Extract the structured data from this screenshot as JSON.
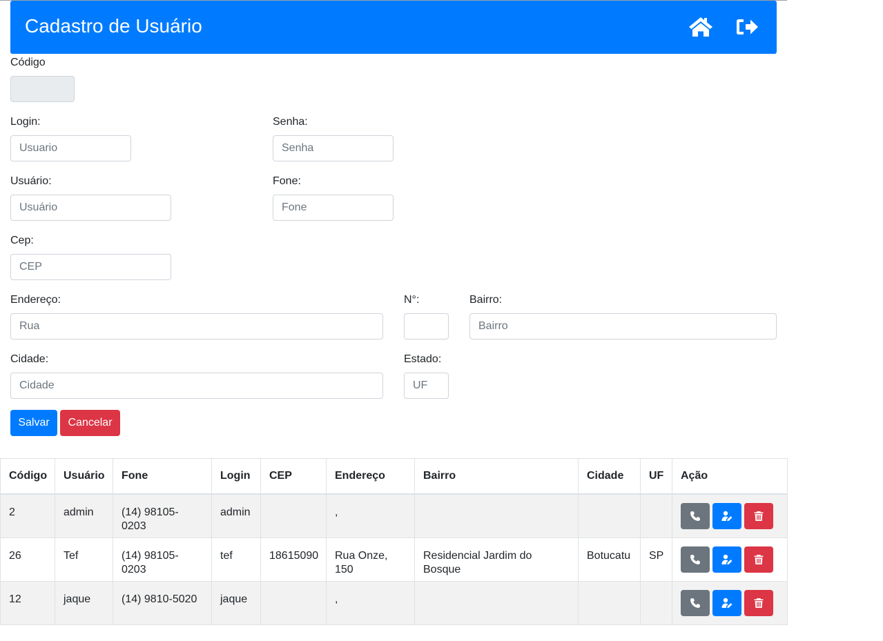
{
  "header": {
    "title": "Cadastro de Usuário",
    "home_icon": "home-icon",
    "logout_icon": "sign-out-icon"
  },
  "form": {
    "codigo_label": "Código",
    "login_label": "Login:",
    "login_placeholder": "Usuario",
    "senha_label": "Senha:",
    "senha_placeholder": "Senha",
    "usuario_label": "Usuário:",
    "usuario_placeholder": "Usuário",
    "fone_label": "Fone:",
    "fone_placeholder": "Fone",
    "cep_label": "Cep:",
    "cep_placeholder": "CEP",
    "endereco_label": "Endereço:",
    "endereco_placeholder": "Rua",
    "numero_label": "N°:",
    "bairro_label": "Bairro:",
    "bairro_placeholder": "Bairro",
    "cidade_label": "Cidade:",
    "cidade_placeholder": "Cidade",
    "estado_label": "Estado:",
    "estado_placeholder": "UF",
    "save_label": "Salvar",
    "cancel_label": "Cancelar"
  },
  "table": {
    "headers": [
      "Código",
      "Usuário",
      "Fone",
      "Login",
      "CEP",
      "Endereço",
      "Bairro",
      "Cidade",
      "UF",
      "Ação"
    ],
    "rows": [
      [
        "2",
        "admin",
        "(14) 98105-0203",
        "admin",
        "",
        ",",
        "",
        "",
        ""
      ],
      [
        "26",
        "Tef",
        "(14) 98105-0203",
        "tef",
        "18615090",
        "Rua Onze, 150",
        "Residencial Jardim do Bosque",
        "Botucatu",
        "SP"
      ],
      [
        "12",
        "jaque",
        "(14) 9810-5020",
        "jaque",
        "",
        ",",
        "",
        "",
        ""
      ]
    ],
    "row_actions": [
      "phone-icon",
      "user-edit-icon",
      "trash-icon"
    ]
  },
  "colors": {
    "primary": "#007bff",
    "danger": "#dc3545",
    "secondary": "#6c757d"
  }
}
